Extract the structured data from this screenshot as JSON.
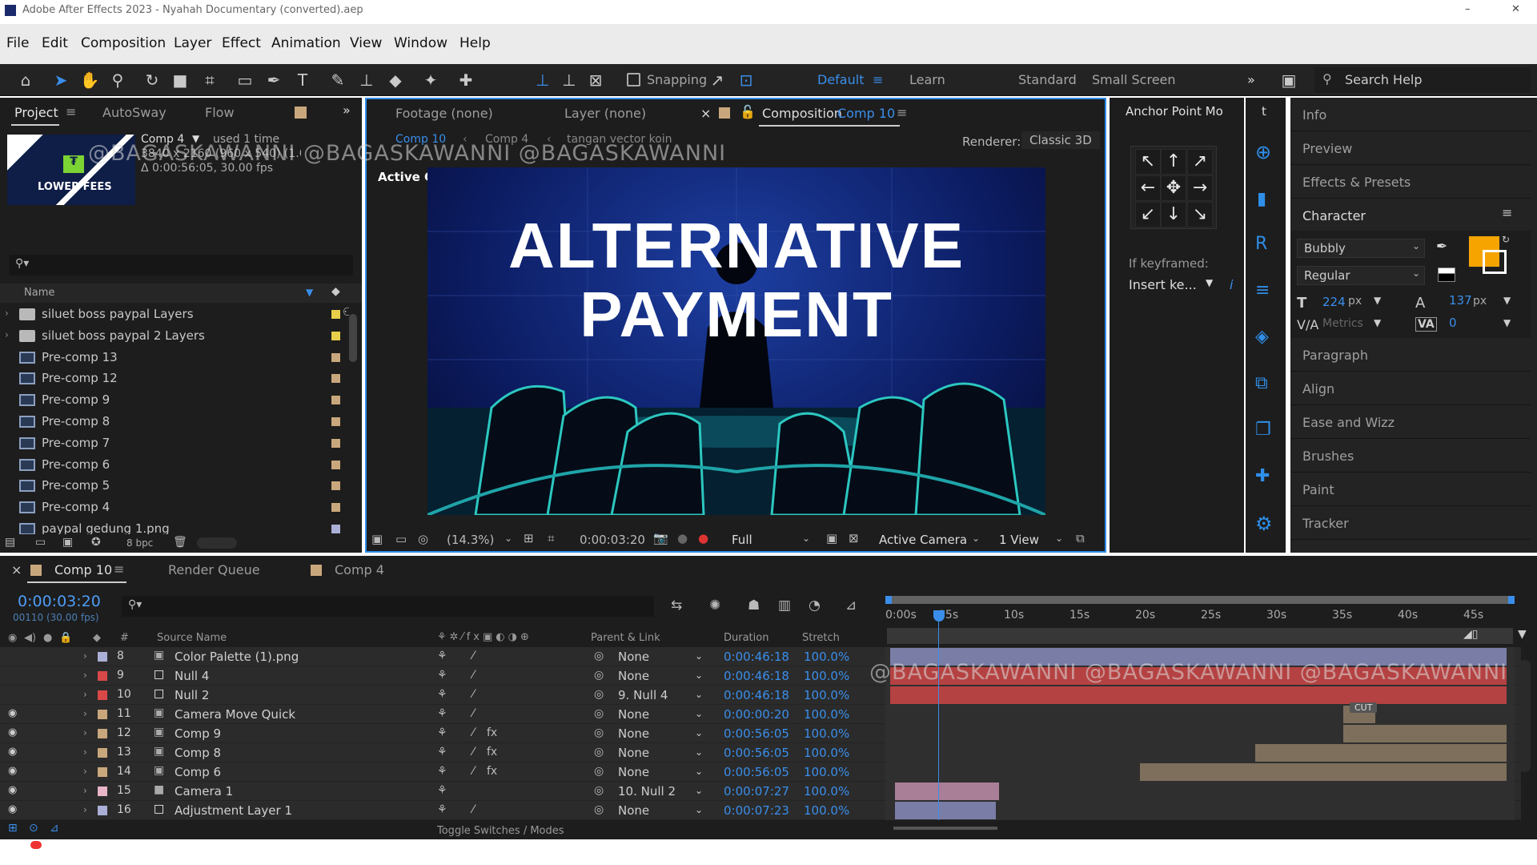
{
  "window": {
    "title": "Adobe After Effects 2023 - Nyahah Documentary (converted).aep"
  },
  "menu": [
    "File",
    "Edit",
    "Composition",
    "Layer",
    "Effect",
    "Animation",
    "View",
    "Window",
    "Help"
  ],
  "toolbar": {
    "snapping": "Snapping",
    "workspaces": [
      "Default",
      "Learn",
      "Standard",
      "Small Screen"
    ],
    "search_placeholder": "Search Help"
  },
  "project": {
    "tabs": [
      "Project",
      "AutoSway",
      "Flow"
    ],
    "selected": {
      "name": "Comp 4",
      "usage": "used 1 time",
      "dims": "3840 x 2160 (960 x 540) (1.00)",
      "duration": "Δ 0:00:56:05, 30.00 fps",
      "thumb_text": "LOWER FEES"
    },
    "column": "Name",
    "items": [
      {
        "name": "siluet boss paypal Layers",
        "type": "folder",
        "color": "#e8d04a"
      },
      {
        "name": "siluet boss paypal 2 Layers",
        "type": "folder",
        "color": "#e8d04a"
      },
      {
        "name": "Pre-comp 13",
        "type": "comp",
        "color": "#c9a77c"
      },
      {
        "name": "Pre-comp 12",
        "type": "comp",
        "color": "#c9a77c"
      },
      {
        "name": "Pre-comp 9",
        "type": "comp",
        "color": "#c9a77c"
      },
      {
        "name": "Pre-comp 8",
        "type": "comp",
        "color": "#c9a77c"
      },
      {
        "name": "Pre-comp 7",
        "type": "comp",
        "color": "#c9a77c"
      },
      {
        "name": "Pre-comp 6",
        "type": "comp",
        "color": "#c9a77c"
      },
      {
        "name": "Pre-comp 5",
        "type": "comp",
        "color": "#c9a77c"
      },
      {
        "name": "Pre-comp 4",
        "type": "comp",
        "color": "#c9a77c"
      },
      {
        "name": "paypal gedung 1.png",
        "type": "file",
        "color": "#aab0d6"
      }
    ],
    "bpc": "8 bpc"
  },
  "viewer": {
    "tabs": {
      "footage": "Footage (none)",
      "layer": "Layer (none)",
      "comp_prefix": "Composition",
      "comp_name": "Comp 10"
    },
    "breadcrumbs": [
      "Comp 10",
      "Comp 4",
      "tangan vector koin"
    ],
    "renderer_label": "Renderer:",
    "renderer": "Classic 3D",
    "active_camera": "Active Camera",
    "title_line1": "ALTERNATIVE",
    "title_line2": "PAYMENT",
    "zoom": "(14.3%)",
    "time": "0:00:03:20",
    "resolution": "Full",
    "camera": "Active Camera",
    "views": "1 View"
  },
  "anchor": {
    "title": "Anchor Point Mo",
    "tab2": "t",
    "if_keyframed": "If keyframed:",
    "insert": "Insert ke..."
  },
  "right_panels": [
    "Info",
    "Preview",
    "Effects & Presets",
    "Character",
    "Paragraph",
    "Align",
    "Ease and Wizz",
    "Brushes",
    "Paint",
    "Tracker"
  ],
  "character": {
    "font": "Bubbly",
    "style": "Regular",
    "size": "224",
    "size_unit": "px",
    "leading": "137",
    "leading_unit": "px",
    "kerning": "Metrics",
    "tracking": "0",
    "fill": "#f5a400"
  },
  "watermark": "@BAGASKAWANNI @BAGASKAWANNI @BAGASKAWANNI",
  "timeline": {
    "tabs": [
      "Comp 10",
      "Render Queue",
      "Comp 4"
    ],
    "timecode": "0:00:03:20",
    "frames": "00110 (30.00 fps)",
    "headers": {
      "num": "#",
      "source": "Source Name",
      "parent": "Parent & Link",
      "duration": "Duration",
      "stretch": "Stretch"
    },
    "ruler": [
      "0:00s",
      "05s",
      "10s",
      "15s",
      "20s",
      "25s",
      "30s",
      "35s",
      "40s",
      "45s"
    ],
    "footer": "Toggle Switches / Modes",
    "cut_label": "CUT",
    "layers": [
      {
        "num": "8",
        "name": "Color Palette (1).png",
        "color": "#aab0d6",
        "icon": "img",
        "parent": "None",
        "duration": "0:00:46:18",
        "stretch": "100.0%",
        "vis": false
      },
      {
        "num": "9",
        "name": "Null 4",
        "color": "#d94848",
        "icon": "null",
        "parent": "None",
        "duration": "0:00:46:18",
        "stretch": "100.0%",
        "vis": false
      },
      {
        "num": "10",
        "name": "Null 2",
        "color": "#d94848",
        "icon": "null",
        "parent": "9. Null 4",
        "duration": "0:00:46:18",
        "stretch": "100.0%",
        "vis": false
      },
      {
        "num": "11",
        "name": "Camera Move Quick",
        "color": "#c9a77c",
        "icon": "comp",
        "parent": "None",
        "duration": "0:00:00:20",
        "stretch": "100.0%",
        "vis": true
      },
      {
        "num": "12",
        "name": "Comp 9",
        "color": "#c9a77c",
        "icon": "comp",
        "parent": "None",
        "duration": "0:00:56:05",
        "stretch": "100.0%",
        "vis": true
      },
      {
        "num": "13",
        "name": "Comp 8",
        "color": "#c9a77c",
        "icon": "comp",
        "parent": "None",
        "duration": "0:00:56:05",
        "stretch": "100.0%",
        "vis": true
      },
      {
        "num": "14",
        "name": "Comp 6",
        "color": "#c9a77c",
        "icon": "comp",
        "parent": "None",
        "duration": "0:00:56:05",
        "stretch": "100.0%",
        "vis": true
      },
      {
        "num": "15",
        "name": "Camera 1",
        "color": "#e8b4c8",
        "icon": "cam",
        "parent": "10. Null 2",
        "duration": "0:00:07:27",
        "stretch": "100.0%",
        "vis": true
      },
      {
        "num": "16",
        "name": "Adjustment Layer 1",
        "color": "#aab0d6",
        "icon": "null",
        "parent": "None",
        "duration": "0:00:07:23",
        "stretch": "100.0%",
        "vis": true
      }
    ]
  }
}
